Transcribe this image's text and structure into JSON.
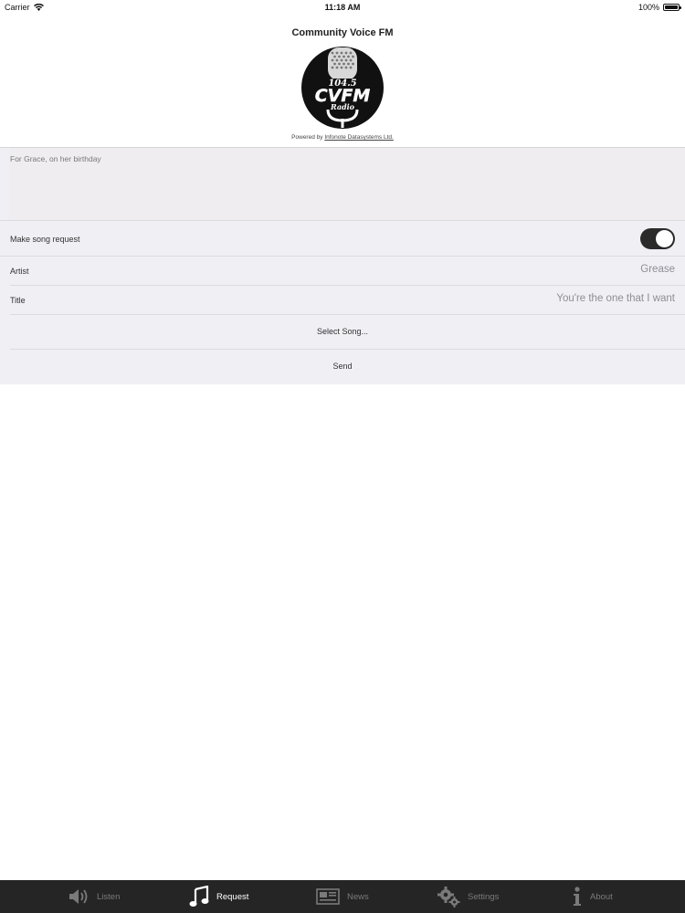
{
  "status_bar": {
    "carrier": "Carrier",
    "time": "11:18 AM",
    "battery": "100%",
    "battery_level": 1.0
  },
  "header": {
    "title": "Community Voice FM",
    "logo_text": {
      "frequency": "104.5",
      "call_sign": "CVFM",
      "tagline": "Radio"
    },
    "powered_prefix": "Powered by",
    "powered_link": "Infonote Datasystems Ltd."
  },
  "form": {
    "message": "For Grace, on her birthday",
    "make_request_label": "Make song request",
    "make_request_on": true,
    "artist_label": "Artist",
    "artist_value": "Grease",
    "title_label": "Title",
    "title_value": "You're the one that I want",
    "select_song_label": "Select Song...",
    "send_label": "Send"
  },
  "tabbar": {
    "items": [
      {
        "label": "Listen",
        "icon": "speaker-icon",
        "active": false
      },
      {
        "label": "Request",
        "icon": "music-note-icon",
        "active": true
      },
      {
        "label": "News",
        "icon": "newspaper-icon",
        "active": false
      },
      {
        "label": "Settings",
        "icon": "gears-icon",
        "active": false
      },
      {
        "label": "About",
        "icon": "info-icon",
        "active": false
      }
    ]
  },
  "colors": {
    "form_bg": "#efeff4",
    "tabbar_bg": "#252525",
    "toggle_on": "#2b2b2b"
  }
}
